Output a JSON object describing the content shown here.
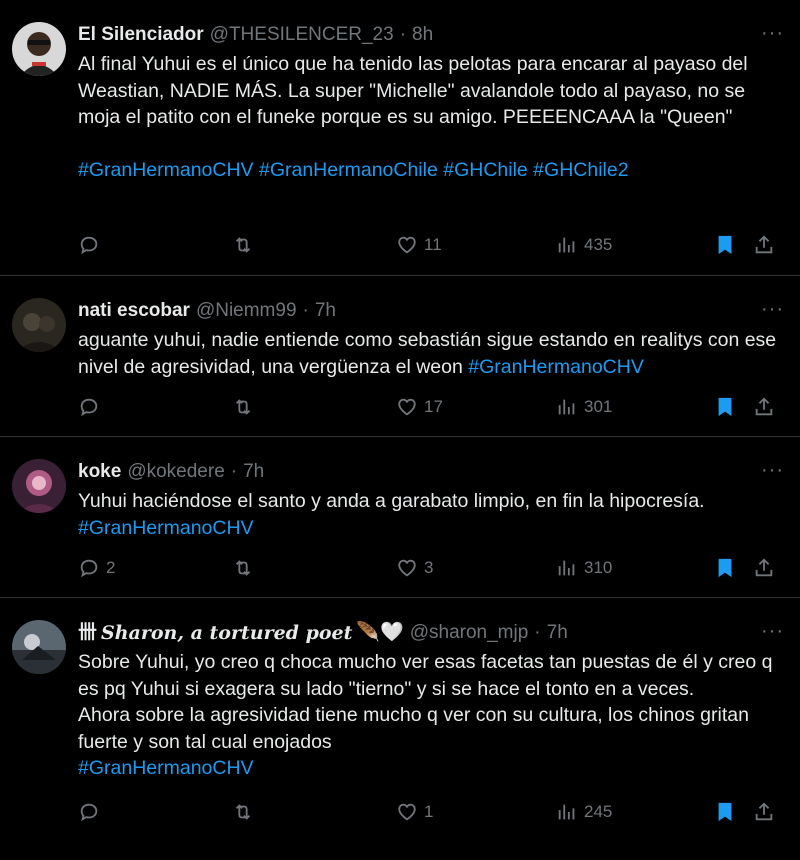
{
  "tweets": [
    {
      "name": "El Silenciador",
      "handle": "@THESILENCER_23",
      "time": "8h",
      "text": "Al final Yuhui es el único que ha tenido las pelotas para encarar al payaso del Weastian, NADIE MÁS. La super \"Michelle\" avalandole todo al payaso, no se moja el patito con el funeke porque es su amigo. PEEEENCAAA la \"Queen\"",
      "hashtags": "#GranHermanoCHV #GranHermanoChile #GHChile #GHChile2",
      "replies": "",
      "likes": "11",
      "views": "435"
    },
    {
      "name": "nati escobar",
      "handle": "@Niemm99",
      "time": "7h",
      "text": "aguante yuhui, nadie entiende como sebastián sigue estando en realitys con ese nivel de agresividad, una vergüenza el weon ",
      "hashtags": "#GranHermanoCHV",
      "replies": "",
      "likes": "17",
      "views": "301"
    },
    {
      "name": "koke",
      "handle": "@kokedere",
      "time": "7h",
      "text": "Yuhui haciéndose el santo y anda a garabato limpio, en fin la hipocresía.",
      "hashtags": "#GranHermanoCHV",
      "replies": "2",
      "likes": "3",
      "views": "310"
    },
    {
      "name": "𝑺𝒉𝒂𝒓𝒐𝒏, 𝒂 𝒕𝒐𝒓𝒕𝒖𝒓𝒆𝒅 𝒑𝒐𝒆𝒕",
      "name_prefix": "卌",
      "name_suffix": "🪶🤍",
      "handle": "@sharon_mjp",
      "time": "7h",
      "text": "Sobre Yuhui, yo creo q choca mucho ver esas facetas tan puestas de él y creo q es pq Yuhui si exagera su lado \"tierno\" y si se hace el tonto en a veces.\nAhora sobre la agresividad tiene mucho q ver con su cultura, los chinos gritan fuerte y son tal cual enojados",
      "hashtags": "#GranHermanoCHV",
      "replies": "",
      "likes": "1",
      "views": "245"
    }
  ],
  "separator": "·",
  "more_label": "···",
  "colors": {
    "background": "#000000",
    "text": "#e7e9ea",
    "muted": "#71767b",
    "link": "#1d9bf0",
    "bookmark": "#1d9bf0"
  },
  "icons": [
    "reply-icon",
    "retweet-icon",
    "like-icon",
    "views-icon",
    "bookmark-icon",
    "share-icon",
    "more-icon"
  ]
}
